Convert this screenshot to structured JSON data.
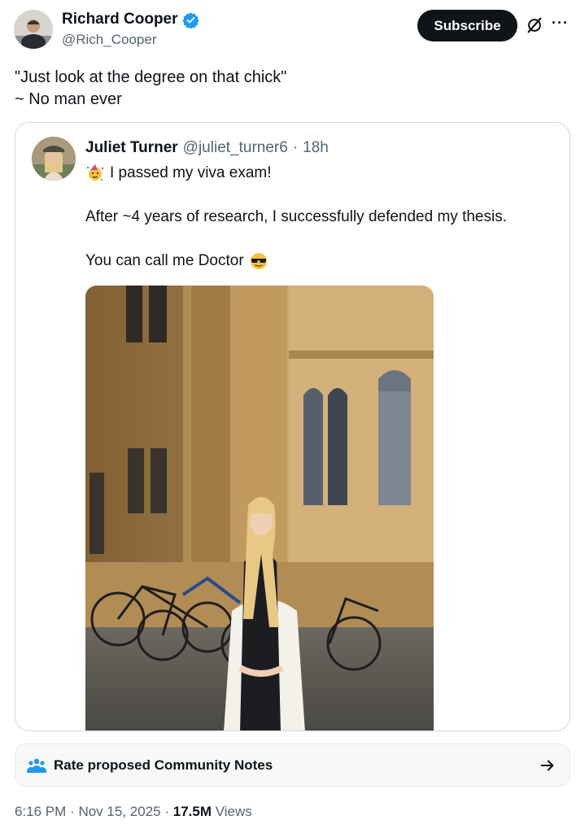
{
  "author": {
    "name": "Richard Cooper",
    "handle": "@Rich_Cooper",
    "verified_color": "#1d9bf0"
  },
  "actions": {
    "subscribe_label": "Subscribe",
    "grok_icon": "grok-icon",
    "more_icon": "more-icon",
    "more_glyph": "···"
  },
  "tweet": {
    "line1": "\"Just look at the degree on that chick\"",
    "line2": "~ No man ever"
  },
  "quote": {
    "name": "Juliet Turner",
    "handle": "@juliet_turner6",
    "separator": "·",
    "time": "18h",
    "line1": "I passed my viva exam!",
    "line2": "After ~4 years of research, I successfully defended my thesis.",
    "line3": "You can call me Doctor",
    "emoji1": "party-face-emoji",
    "emoji2": "sunglasses-emoji"
  },
  "community_notes": {
    "label": "Rate proposed Community Notes",
    "icon": "people-icon",
    "arrow": "arrow-right-icon"
  },
  "meta": {
    "time": "6:16 PM",
    "dot1": "·",
    "date": "Nov 15, 2025",
    "dot2": "·",
    "views_count": "17.5M",
    "views_label": "Views"
  }
}
